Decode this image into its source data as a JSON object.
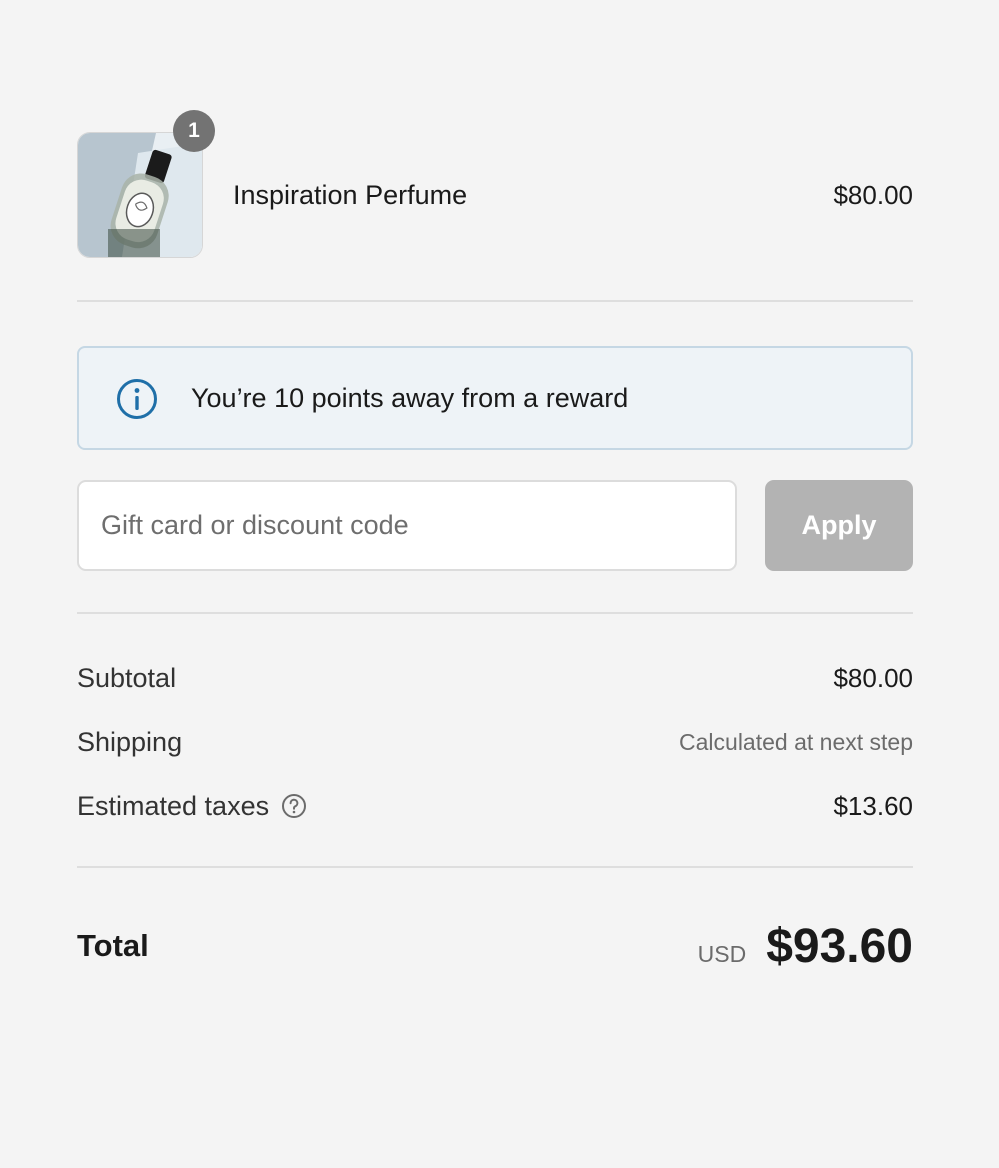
{
  "product": {
    "name": "Inspiration Perfume",
    "price": "$80.00",
    "quantity": "1",
    "image_icon": "perfume-bottle-image"
  },
  "notice": {
    "icon": "info-icon",
    "text": "You’re 10 points away from a reward",
    "accent_color": "#1f6fa8"
  },
  "discount": {
    "placeholder": "Gift card or discount code",
    "value": "",
    "apply_label": "Apply"
  },
  "summary": {
    "subtotal_label": "Subtotal",
    "subtotal_value": "$80.00",
    "shipping_label": "Shipping",
    "shipping_value": "Calculated at next step",
    "taxes_label": "Estimated taxes",
    "taxes_icon": "question-circle-icon",
    "taxes_value": "$13.60"
  },
  "total": {
    "label": "Total",
    "currency": "USD",
    "amount": "$93.60"
  },
  "colors": {
    "background": "#f4f4f4",
    "apply_disabled": "#b3b3b3",
    "badge": "#737373"
  }
}
